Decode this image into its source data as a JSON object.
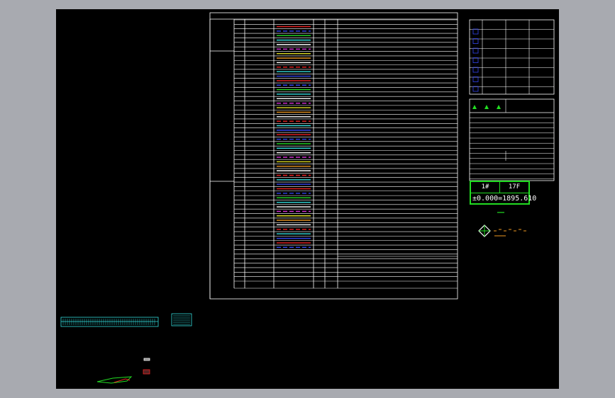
{
  "app": {
    "title": ""
  },
  "canvas": {
    "background": "#000000",
    "frame_color": "#a8aab0"
  },
  "colors": {
    "line": "#ffffff",
    "accent_green": "#22dd22",
    "accent_cyan": "#33dddd",
    "accent_red": "#ee2222",
    "accent_magenta": "#dd33dd",
    "accent_blue": "#3344ee",
    "accent_yellow": "#dddd22",
    "accent_orange": "#ee9922"
  },
  "elevation_box": {
    "left_label": "1#",
    "right_label": "17F",
    "value": "±0.000=1895.610"
  },
  "icons": {
    "north_arrow": "north-arrow-icon",
    "section_markers": "triangle-marker-icon",
    "legend_symbols": "square-symbol-icon"
  }
}
